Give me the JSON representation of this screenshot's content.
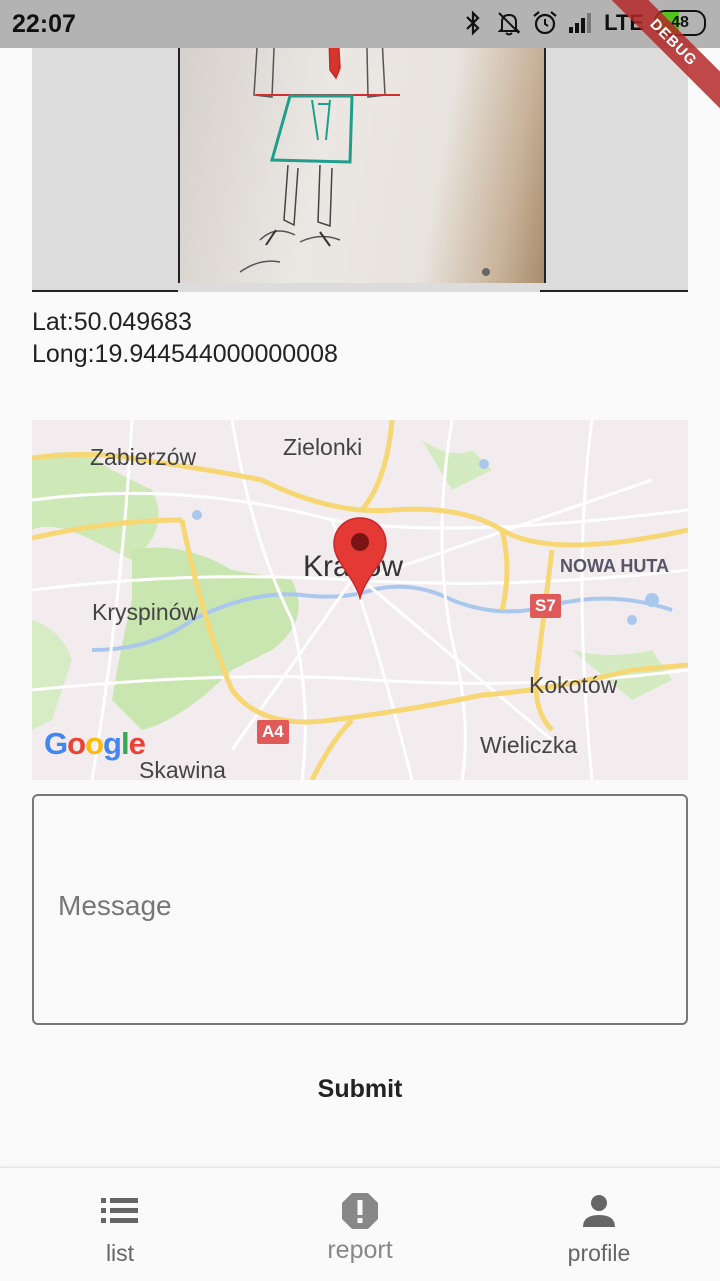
{
  "status_bar": {
    "time": "22:07",
    "network": "LTE",
    "battery_level": "48",
    "icons": [
      "bluetooth-icon",
      "mute-icon",
      "alarm-icon",
      "signal-icon",
      "battery-icon"
    ]
  },
  "debug_banner": "DEBUG",
  "location": {
    "lat_text": "Lat:50.049683",
    "long_text": "Long:19.944544000000008"
  },
  "map": {
    "labels": {
      "zabierzow": "Zabierzów",
      "zielonki": "Zielonki",
      "krakow": "Kraków",
      "nowa_huta": "NOWA HUTA",
      "kryspinow": "Kryspinów",
      "kokotow": "Kokotów",
      "wieliczka": "Wieliczka",
      "skawina": "Skawina"
    },
    "shields": {
      "s7": "S7",
      "a4": "A4"
    },
    "attribution": "Google"
  },
  "form": {
    "message_placeholder": "Message",
    "message_value": "",
    "submit_label": "Submit"
  },
  "bottom_nav": {
    "items": [
      {
        "label": "list",
        "icon": "list-icon"
      },
      {
        "label": "report",
        "icon": "report-icon"
      },
      {
        "label": "profile",
        "icon": "profile-icon"
      }
    ],
    "active": "report"
  },
  "colors": {
    "pin": "#e53935",
    "road": "#f7d774",
    "green_area": "#cfe8b8",
    "water": "#aac8ee",
    "shield": "#e05a5a"
  }
}
